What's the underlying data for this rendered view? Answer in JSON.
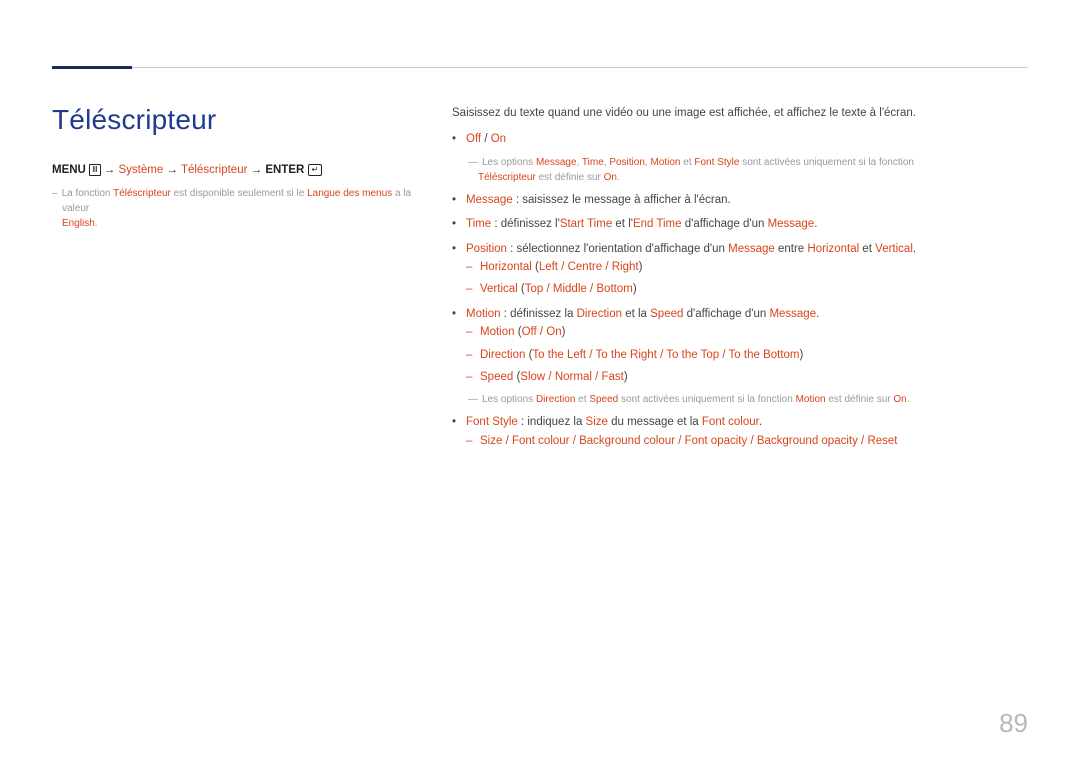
{
  "page_number": "89",
  "title": "Téléscripteur",
  "menu_path": {
    "menu": "MENU",
    "arrow": "→",
    "system": "Système",
    "telescripteur": "Téléscripteur",
    "enter": "ENTER"
  },
  "left_note": {
    "pre": "La fonction ",
    "hl1": "Téléscripteur",
    "mid": " est disponible seulement si le ",
    "hl2": "Langue des menus",
    "mid2": " a la valeur ",
    "hl3": "English",
    "end": "."
  },
  "intro": "Saisissez du texte quand une vidéo ou une image est affichée, et affichez le texte à l'écran.",
  "b1": {
    "off": "Off",
    "slash": " / ",
    "on": "On"
  },
  "note1": {
    "pre": "Les options ",
    "m": "Message",
    "c1": ", ",
    "t": "Time",
    "c2": ", ",
    "p": "Position",
    "c3": ", ",
    "mo": "Motion",
    "et": " et ",
    "fs": "Font Style",
    "mid": " sont activées uniquement si la fonction ",
    "tele": "Téléscripteur",
    "mid2": " est définie sur ",
    "on": "On",
    "end": "."
  },
  "b_msg": {
    "hl": "Message",
    "txt": " : saisissez le message à afficher à l'écran."
  },
  "b_time": {
    "hl": "Time",
    "pre": " : définissez l'",
    "st": "Start Time",
    "mid": " et l'",
    "et": "End Time",
    "mid2": " d'affichage d'un ",
    "msg": "Message",
    "end": "."
  },
  "b_pos": {
    "hl": "Position",
    "pre": " : sélectionnez l'orientation d'affichage d'un ",
    "msg": "Message",
    "mid": " entre ",
    "h": "Horizontal",
    "et": " et ",
    "v": "Vertical",
    "end": "."
  },
  "pos_h": {
    "h": "Horizontal",
    "op": " (",
    "a": "Left",
    "s": " / ",
    "b": "Centre",
    "c": "Right",
    "cp": ")"
  },
  "pos_v": {
    "v": "Vertical",
    "op": " (",
    "a": "Top",
    "s": " / ",
    "b": "Middle",
    "c": "Bottom",
    "cp": ")"
  },
  "b_motion": {
    "hl": "Motion",
    "pre": " : définissez la ",
    "dir": "Direction",
    "mid": " et la ",
    "sp": "Speed",
    "mid2": " d'affichage d'un ",
    "msg": "Message",
    "end": "."
  },
  "m_mo": {
    "mo": "Motion",
    "op": " (",
    "a": "Off",
    "s": " / ",
    "b": "On",
    "cp": ")"
  },
  "m_dir": {
    "d": "Direction",
    "op": " (",
    "a": "To the Left",
    "s": " / ",
    "b": "To the Right",
    "c": "To the Top",
    "e": "To the Bottom",
    "cp": ")"
  },
  "m_sp": {
    "sp": "Speed",
    "op": " (",
    "a": "Slow",
    "s": " / ",
    "b": "Normal",
    "c": "Fast",
    "cp": ")"
  },
  "note2": {
    "pre": "Les options ",
    "d": "Direction",
    "et": " et ",
    "sp": "Speed",
    "mid": " sont activées uniquement si la fonction ",
    "mo": "Motion",
    "mid2": " est définie sur ",
    "on": "On",
    "end": "."
  },
  "b_fs": {
    "hl": "Font Style",
    "pre": " : indiquez la ",
    "sz": "Size",
    "mid": " du message et la ",
    "fc": "Font colour",
    "end": "."
  },
  "fs_list": {
    "a": "Size",
    "s": " / ",
    "b": "Font colour",
    "c": "Background colour",
    "d": "Font opacity",
    "e": "Background opacity",
    "f": "Reset"
  }
}
